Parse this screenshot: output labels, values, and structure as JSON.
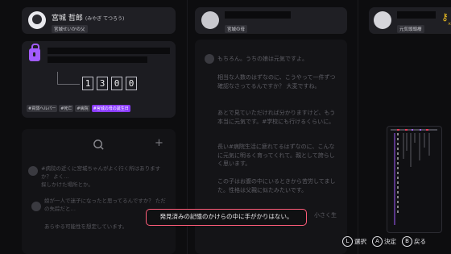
{
  "left_profile": {
    "name": "宮城 哲郎",
    "reading": "(みやぎ てつろう)",
    "subtitle": "宮城せいかの父"
  },
  "lock_panel": {
    "digits": [
      "1",
      "3",
      "0",
      "0"
    ],
    "tags": [
      "#買弱ヘルパー",
      "#死亡",
      "#病院",
      "#宮城の母の誕生日"
    ],
    "highlighted_tag_index": 3
  },
  "middle_profile": {
    "subtitle": "宮城の母"
  },
  "middle_body": {
    "paragraphs": [
      "もちろん。うちの娘は元気ですよ。",
      "相当な人数のはずなのに、こうやって一件ずつ確認なさってるんですか？ 大変ですね。",
      "あとで見ていただければ分かりますけど、もう本当に元気です。#学校にも行けるくらいに。",
      "長い#病院生活に疲れてるはずなのに、こんなに元気に明るく育ってくれて。親として誇らしく思います。",
      "この子はお腹の中にいるときから苦労してました。性格は父親に似たみたいです。"
    ],
    "trailing_text": "小さく生"
  },
  "left_chat": {
    "line1": "#病院の近くに宮城ちゃんがよく行く所はありますか？ よく…",
    "line2": "探しかけた場所とか。",
    "line3": "娘が一人で迷子になったと思ってるんですか？ ただの失踪だと…",
    "line4": "あらゆる可能性を想定しています。"
  },
  "right_profile": {
    "subtitle": "元気頭頭療",
    "badge": "×1"
  },
  "toast": {
    "message": "発見済みの記憶のかけらの中に手がかりはない。"
  },
  "footer": {
    "select_key": "L",
    "select_label": "選択",
    "confirm_key": "A",
    "confirm_label": "決定",
    "back_key": "B",
    "back_label": "戻る"
  },
  "colors": {
    "accent_purple": "#8b3dff",
    "toast_border": "#ff5d7a",
    "key_yellow": "#f3c321"
  }
}
